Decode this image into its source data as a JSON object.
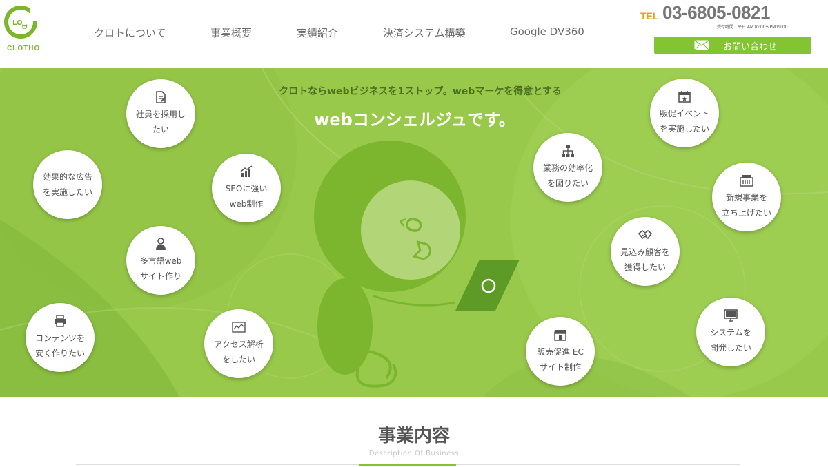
{
  "brand": {
    "logo_text": "CLOTHO",
    "accent": "#84c332",
    "tel_accent": "#e8a21a"
  },
  "nav": {
    "items": [
      {
        "label": "クロトについて"
      },
      {
        "label": "事業概要"
      },
      {
        "label": "実績紹介"
      },
      {
        "label": "決済システム構築"
      },
      {
        "label": "Google DV360"
      }
    ]
  },
  "contact": {
    "tel_label": "TEL",
    "tel_number": "03-6805-0821",
    "hours": "受付時間　平日 AM10:00～PM19:00",
    "button_label": "お問い合わせ"
  },
  "hero": {
    "tagline": "クロトならwebビジネスを1ストップ。webマーケを得意とする",
    "headline": "webコンシェルジュです。",
    "bubbles": [
      {
        "icon": "document-edit-icon",
        "line1": "社員を採用し",
        "line2": "たい"
      },
      {
        "icon": "none",
        "line1": "効果的な広告",
        "line2": "を実施したい"
      },
      {
        "icon": "growth-chart-icon",
        "line1": "SEOに強い",
        "line2": "web制作"
      },
      {
        "icon": "person-icon",
        "line1": "多言語web",
        "line2": "サイト作り"
      },
      {
        "icon": "printer-icon",
        "line1": "コンテンツを",
        "line2": "安く作りたい"
      },
      {
        "icon": "analytics-icon",
        "line1": "アクセス解析",
        "line2": "をしたい"
      },
      {
        "icon": "calendar-icon",
        "line1": "販促イベント",
        "line2": "を実施したい"
      },
      {
        "icon": "org-chart-icon",
        "line1": "業務の効率化",
        "line2": "を図りたい"
      },
      {
        "icon": "building-icon",
        "line1": "新規事業を",
        "line2": "立ち上げたい"
      },
      {
        "icon": "handshake-icon",
        "line1": "見込み顧客を",
        "line2": "獲得したい"
      },
      {
        "icon": "shop-icon",
        "line1": "販売促進 EC",
        "line2": "サイト制作"
      },
      {
        "icon": "monitor-icon",
        "line1": "システムを",
        "line2": "開発したい"
      }
    ]
  },
  "section": {
    "title": "事業内容",
    "subtitle": "Description Of Business"
  }
}
